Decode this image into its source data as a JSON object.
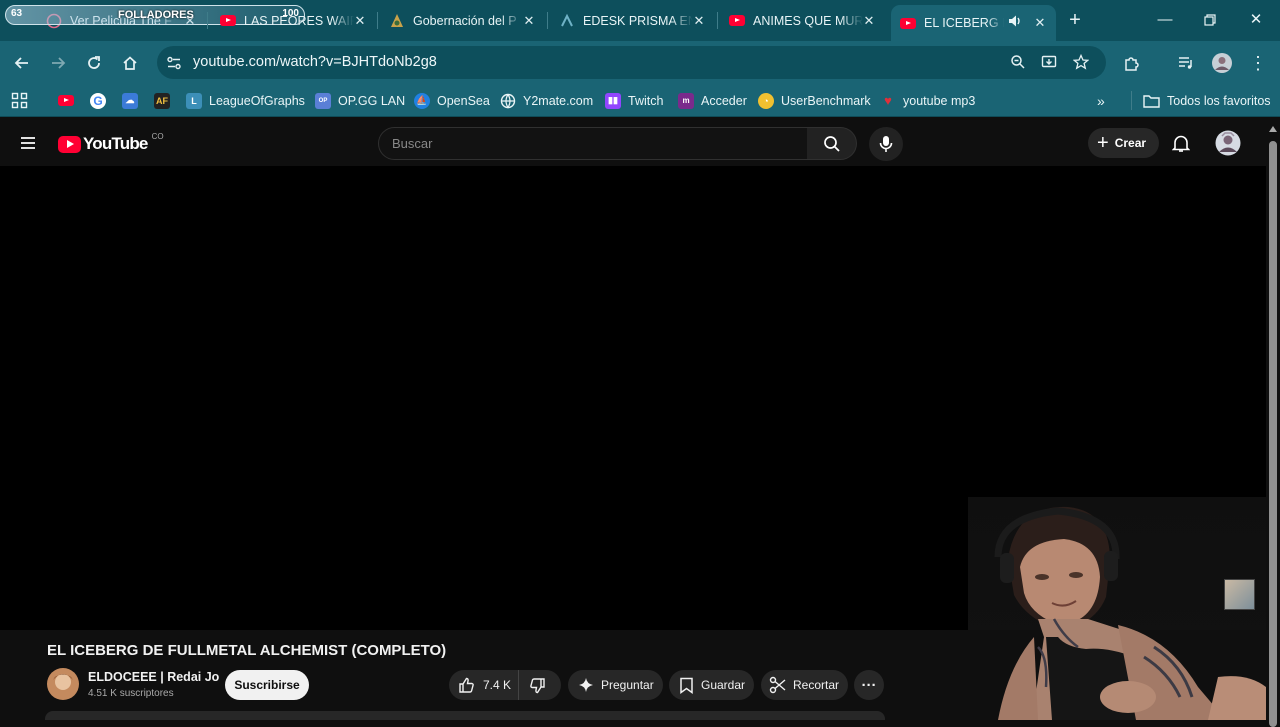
{
  "browser": {
    "stream_overlay": {
      "left": "63",
      "label": "FOLLADORES",
      "right": "100"
    },
    "tabs": [
      {
        "title": "Ver Pelicula The F",
        "icon": "globe-icon"
      },
      {
        "title": "LAS PEORES WAIFU",
        "icon": "youtube-icon"
      },
      {
        "title": "Gobernación del P",
        "icon": "crest-icon"
      },
      {
        "title": "EDESK PRISMA EN",
        "icon": "edesk-icon"
      },
      {
        "title": "ANIMES QUE MUR",
        "icon": "youtube-icon"
      },
      {
        "title": "EL ICEBERG DE",
        "icon": "youtube-icon",
        "active": true
      }
    ],
    "url": "youtube.com/watch?v=BJHTdoNb2g8",
    "bookmarks": [
      {
        "label": "",
        "icon": "apps-grid-icon"
      },
      {
        "label": "",
        "icon": "youtube-icon"
      },
      {
        "label": "",
        "icon": "google-icon"
      },
      {
        "label": "",
        "icon": "cloud-icon"
      },
      {
        "label": "",
        "icon": "af-icon"
      },
      {
        "label": "LeagueOfGraphs",
        "icon": "league-icon"
      },
      {
        "label": "OP.GG LAN",
        "icon": "opgg-icon"
      },
      {
        "label": "OpenSea",
        "icon": "opensea-icon"
      },
      {
        "label": "Y2mate.com",
        "icon": "y2mate-icon"
      },
      {
        "label": "Twitch",
        "icon": "twitch-icon"
      },
      {
        "label": "Acceder",
        "icon": "acceder-icon"
      },
      {
        "label": "UserBenchmark",
        "icon": "userbenchmark-icon"
      },
      {
        "label": "youtube mp3",
        "icon": "mp3-icon"
      }
    ],
    "all_bookmarks_label": "Todos los favoritos"
  },
  "youtube": {
    "logo_text": "YouTube",
    "country_code": "CO",
    "search_placeholder": "Buscar",
    "create_label": "Crear",
    "video": {
      "title": "EL ICEBERG DE FULLMETAL ALCHEMIST (COMPLETO)",
      "channel_name": "ELDOCEEE | Redai Jo",
      "subscribers": "4.51 K suscriptores",
      "subscribe_label": "Suscribirse",
      "likes": "7.4 K",
      "ask_label": "Preguntar",
      "save_label": "Guardar",
      "clip_label": "Recortar"
    }
  },
  "colors": {
    "tab_strip": "#0d4f5c",
    "toolbar": "#1a6474",
    "youtube_red": "#ff0033",
    "page_bg": "#0f0f0f"
  }
}
